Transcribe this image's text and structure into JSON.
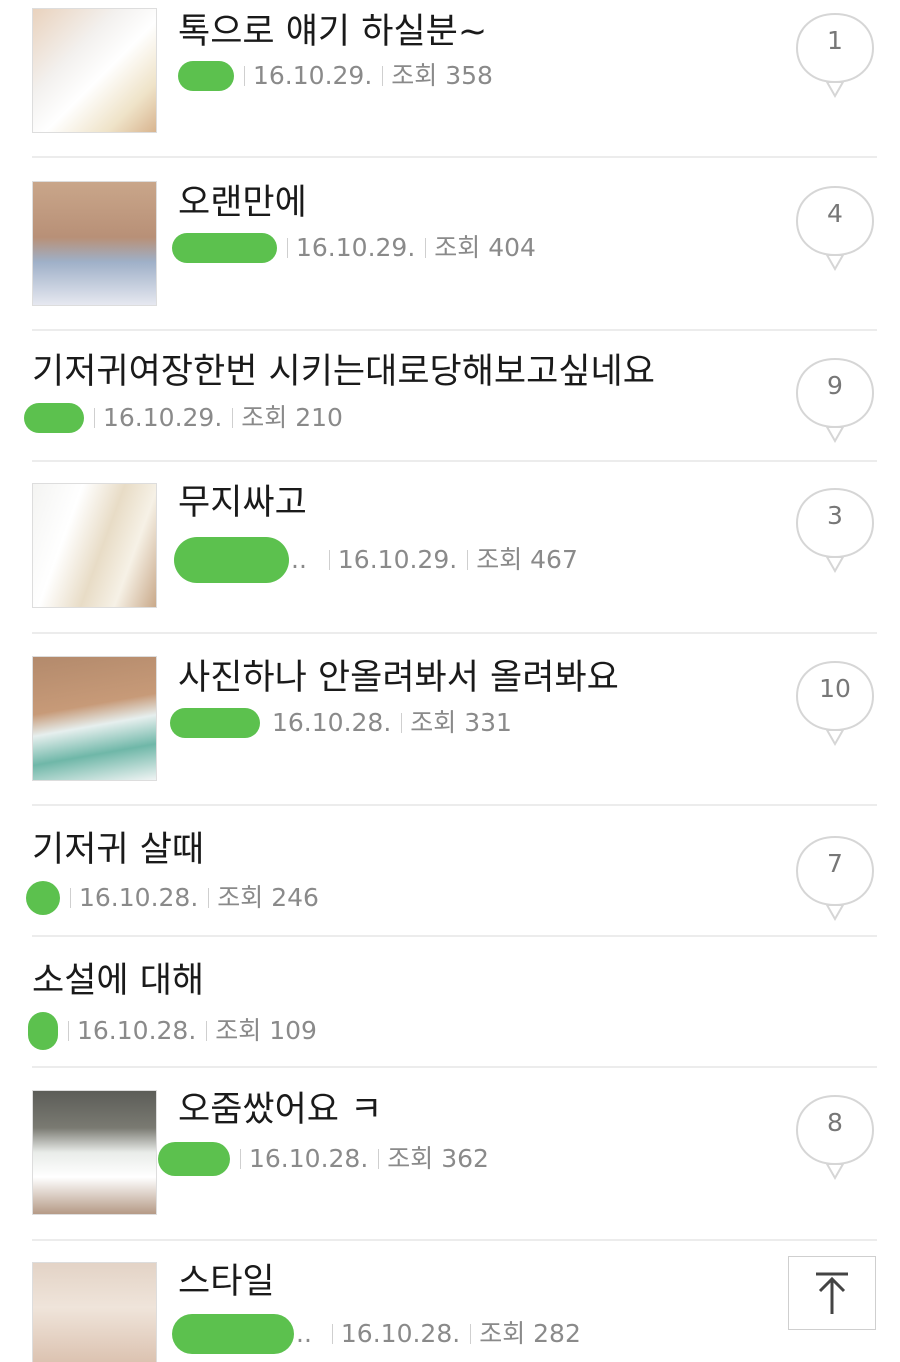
{
  "posts": [
    {
      "title": "톡으로 얘기 하실분~",
      "date": "16.10.29.",
      "views": "조회 358",
      "comments": "1"
    },
    {
      "title": "오랜만에",
      "date": "16.10.29.",
      "views": "조회 404",
      "comments": "4"
    },
    {
      "title": "기저귀여장한번 시키는대로당해보고싶네요",
      "date": "16.10.29.",
      "views": "조회 210",
      "comments": "9"
    },
    {
      "title": "무지싸고",
      "date": "16.10.29.",
      "views": "조회 467",
      "comments": "3"
    },
    {
      "title": "사진하나 안올려봐서 올려봐요",
      "date": "16.10.28.",
      "views": "조회 331",
      "comments": "10"
    },
    {
      "title": "기저귀 살때",
      "date": "16.10.28.",
      "views": "조회 246",
      "comments": "7"
    },
    {
      "title": "소설에 대해",
      "date": "16.10.28.",
      "views": "조회 109",
      "comments": ""
    },
    {
      "title": "오줌쌌어요 ㅋ",
      "date": "16.10.28.",
      "views": "조회 362",
      "comments": "8"
    },
    {
      "title": "스타일",
      "date": "16.10.28.",
      "views": "조회 282",
      "comments": ""
    }
  ],
  "colors": {
    "redaction": "#5cc14e",
    "divider": "#ececec",
    "meta_text": "#8a8a8a"
  },
  "icons": {
    "scroll_top": "arrow-up-to-top-icon",
    "comment": "speech-bubble-icon"
  }
}
